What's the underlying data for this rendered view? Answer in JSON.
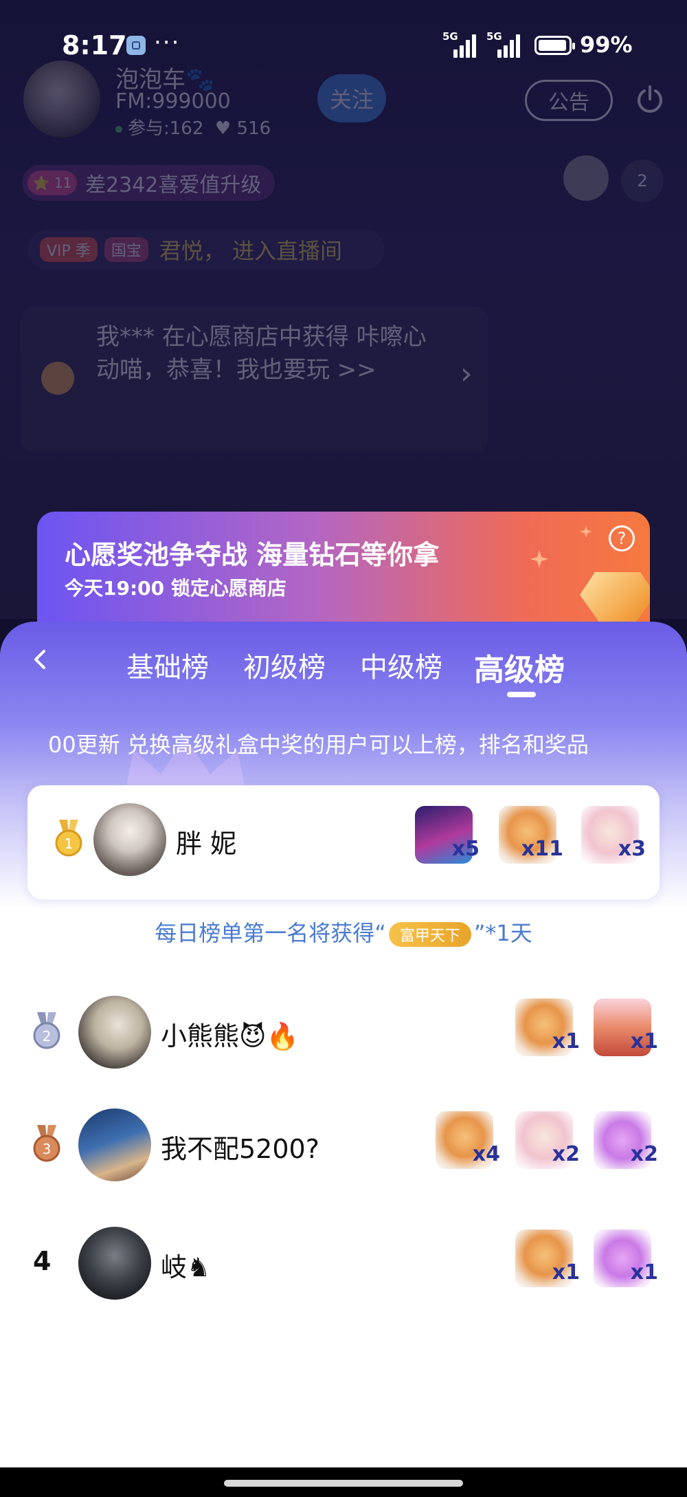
{
  "status_bar": {
    "time": "8:17",
    "more": "···",
    "signal_1": "5G",
    "signal_2": "5G",
    "battery": "99%"
  },
  "room": {
    "host_name": "泡泡车🐾",
    "host_fm": "FM:999000",
    "participants": "参与:162",
    "likes": "♥ 516",
    "follow_label": "关注",
    "notice_label": "公告",
    "level_badge": "⭐ 11",
    "level_text": "差2342喜爱值升级",
    "viewer_count": "2",
    "vip_tag": "VIP 季",
    "guobao_tag": "国宝",
    "enter_text": "君悦， 进入直播间",
    "message": "我*** 在心愿商店中获得 咔嚓心动喵，恭喜！我也要玩 >>"
  },
  "promo": {
    "title": "心愿奖池争夺战 海量钻石等你拿",
    "subtitle": "今天19:00 锁定心愿商店",
    "help": "?"
  },
  "leaderboard": {
    "tabs": [
      "基础榜",
      "初级榜",
      "中级榜",
      "高级榜"
    ],
    "active_tab": "高级榜",
    "marquee": "00更新 兑换高级礼盒中奖的用户可以上榜，排名和奖品",
    "first_prize_prefix": "每日榜单第一名将获得“",
    "first_prize_badge": "富甲天下",
    "first_prize_suffix": "”*1天",
    "rows": [
      {
        "rank": "1",
        "name": "胖 妮",
        "gifts": [
          {
            "icon": "dj-girl-gift-icon",
            "count": "x5"
          },
          {
            "icon": "camera-cat-gift-icon",
            "count": "x11"
          },
          {
            "icon": "princess-bear-gift-icon",
            "count": "x3"
          }
        ]
      },
      {
        "rank": "2",
        "name": "小熊熊😈🔥",
        "gifts": [
          {
            "icon": "camera-cat-gift-icon",
            "count": "x1"
          },
          {
            "icon": "fox-couple-gift-icon",
            "count": "x1"
          }
        ]
      },
      {
        "rank": "3",
        "name": "我不配5200?",
        "gifts": [
          {
            "icon": "camera-cat-gift-icon",
            "count": "x4"
          },
          {
            "icon": "princess-bear-gift-icon",
            "count": "x2"
          },
          {
            "icon": "cupid-hearts-gift-icon",
            "count": "x2"
          }
        ]
      },
      {
        "rank": "4",
        "name": "岐♞",
        "gifts": [
          {
            "icon": "camera-cat-gift-icon",
            "count": "x1"
          },
          {
            "icon": "cupid-hearts-gift-icon",
            "count": "x1"
          }
        ]
      }
    ]
  },
  "colors": {
    "accent_purple": "#6a5ce6",
    "promo_orange": "#f6793f",
    "gift_count": "#28329a",
    "note_blue": "#4a7bd0"
  }
}
